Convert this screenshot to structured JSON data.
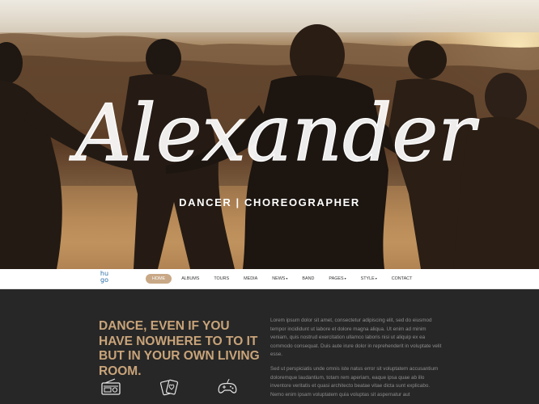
{
  "hero": {
    "title": "Alexander",
    "subtitle": "DANCER | CHOREOGRAPHER"
  },
  "nav": {
    "logo_top": "hu",
    "logo_bottom": "go",
    "items": [
      {
        "label": "HOME",
        "active": true,
        "has_submenu": false
      },
      {
        "label": "ALBUMS",
        "active": false,
        "has_submenu": false
      },
      {
        "label": "TOURS",
        "active": false,
        "has_submenu": false
      },
      {
        "label": "MEDIA",
        "active": false,
        "has_submenu": false
      },
      {
        "label": "NEWS",
        "active": false,
        "has_submenu": true
      },
      {
        "label": "BAND",
        "active": false,
        "has_submenu": false
      },
      {
        "label": "PAGES",
        "active": false,
        "has_submenu": true
      },
      {
        "label": "STYLE",
        "active": false,
        "has_submenu": true
      },
      {
        "label": "CONTACT",
        "active": false,
        "has_submenu": false
      }
    ]
  },
  "content": {
    "headline": "DANCE, EVEN IF YOU HAVE NOWHERE TO TO IT BUT IN YOUR OWN LIVING ROOM.",
    "paragraph1": "Lorem ipsum dolor sit amet, consectetur adipiscing elit, sed do eiusmod tempor incididunt ut labore et dolore magna aliqua. Ut enim ad minim veniam, quis nostrud exercitation ullamco laboris nisi ut aliquip ex ea commodo consequat. Duis aute irure dolor in reprehenderit in voluptate velit esse.",
    "paragraph2": "Sed ut perspiciatis unde omnis iste natus error sit voluptatem accusantium doloremque laudantium, totam rem aperiam, eaque ipsa quae ab illo inventore veritatis et quasi architecto beatae vitae dicta sunt explicabo. Nemo enim ipsam voluptatem quia voluptas sit aspernatur aut",
    "icons": [
      "radio-icon",
      "playing-cards-icon",
      "gamepad-icon"
    ]
  },
  "colors": {
    "accent": "#c9a47a",
    "nav_active_bg": "#c8a886",
    "dark_bg": "#272727",
    "logo": "#2b6ea6"
  }
}
